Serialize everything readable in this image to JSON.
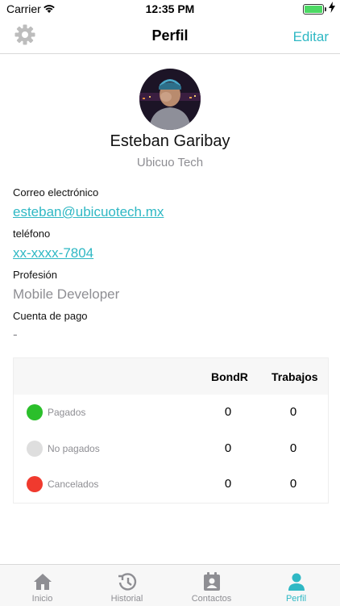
{
  "status_bar": {
    "carrier": "Carrier",
    "time": "12:35 PM"
  },
  "navbar": {
    "title": "Perfil",
    "edit_label": "Editar"
  },
  "profile": {
    "name": "Esteban Garibay",
    "company": "Ubicuo Tech",
    "email_label": "Correo electrónico",
    "email_value": "esteban@ubicuotech.mx",
    "phone_label": "teléfono",
    "phone_value": "xx-xxxx-7804",
    "profession_label": "Profesión",
    "profession_value": "Mobile Developer",
    "payment_label": "Cuenta de pago",
    "payment_value": "-"
  },
  "table": {
    "headers": [
      "BondR",
      "Trabajos"
    ],
    "rows": [
      {
        "label": "Pagados",
        "color": "#2bbf2b",
        "bondr": "0",
        "trabajos": "0"
      },
      {
        "label": "No pagados",
        "color": "#dedede",
        "bondr": "0",
        "trabajos": "0"
      },
      {
        "label": "Cancelados",
        "color": "#f03a2e",
        "bondr": "0",
        "trabajos": "0"
      }
    ]
  },
  "tabs": [
    {
      "label": "Inicio",
      "icon": "home-icon",
      "active": false
    },
    {
      "label": "Historial",
      "icon": "history-icon",
      "active": false
    },
    {
      "label": "Contactos",
      "icon": "contacts-icon",
      "active": false
    },
    {
      "label": "Perfil",
      "icon": "person-icon",
      "active": true
    }
  ],
  "colors": {
    "accent": "#2fb8c4",
    "muted": "#8e8e93"
  }
}
